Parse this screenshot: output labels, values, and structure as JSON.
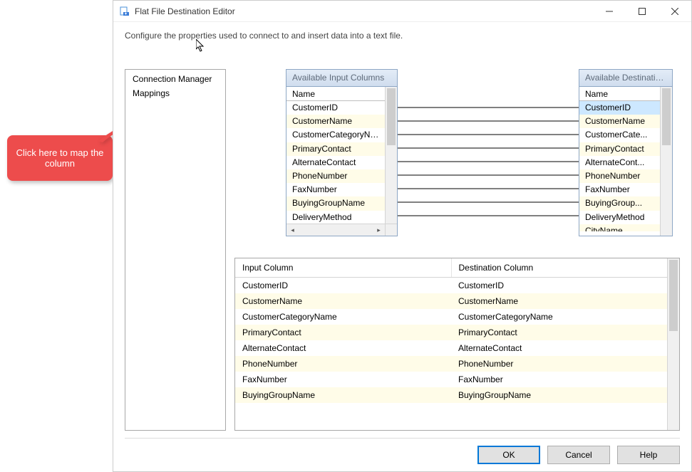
{
  "titlebar": {
    "title": "Flat File Destination Editor"
  },
  "description": "Configure the properties used to connect to and insert data into a text file.",
  "sidebar": {
    "items": [
      {
        "label": "Connection Manager"
      },
      {
        "label": "Mappings"
      }
    ]
  },
  "callout": "Click here to map the column",
  "inputColumns": {
    "title": "Available Input Columns",
    "header": "Name",
    "rows": [
      "CustomerID",
      "CustomerName",
      "CustomerCategoryName",
      "PrimaryContact",
      "AlternateContact",
      "PhoneNumber",
      "FaxNumber",
      "BuyingGroupName",
      "DeliveryMethod"
    ]
  },
  "destColumns": {
    "title": "Available Destinatio...",
    "header": "Name",
    "rows": [
      "CustomerID",
      "CustomerName",
      "CustomerCate...",
      "PrimaryContact",
      "AlternateCont...",
      "PhoneNumber",
      "FaxNumber",
      "BuyingGroup...",
      "DeliveryMethod",
      "CityName"
    ]
  },
  "grid": {
    "headers": [
      "Input Column",
      "Destination Column"
    ],
    "rows": [
      [
        "CustomerID",
        "CustomerID"
      ],
      [
        "CustomerName",
        "CustomerName"
      ],
      [
        "CustomerCategoryName",
        "CustomerCategoryName"
      ],
      [
        "PrimaryContact",
        "PrimaryContact"
      ],
      [
        "AlternateContact",
        "AlternateContact"
      ],
      [
        "PhoneNumber",
        "PhoneNumber"
      ],
      [
        "FaxNumber",
        "FaxNumber"
      ],
      [
        "BuyingGroupName",
        "BuyingGroupName"
      ]
    ]
  },
  "buttons": {
    "ok": "OK",
    "cancel": "Cancel",
    "help": "Help"
  }
}
